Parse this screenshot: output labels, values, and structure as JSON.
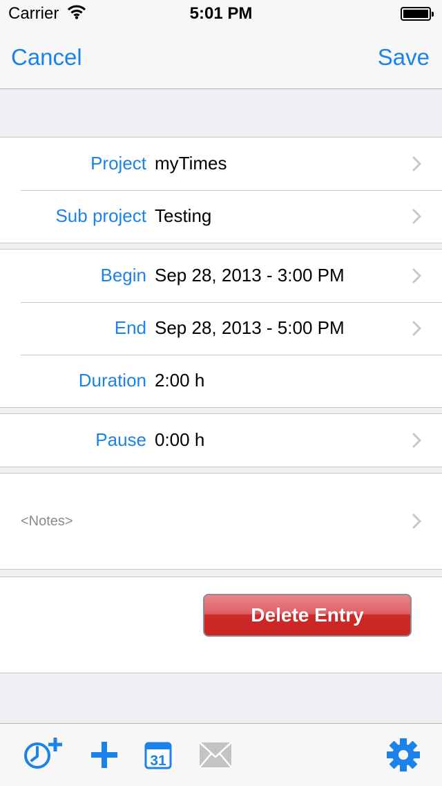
{
  "status_bar": {
    "carrier": "Carrier",
    "time": "5:01 PM"
  },
  "nav": {
    "cancel_label": "Cancel",
    "save_label": "Save"
  },
  "project_group": {
    "project_label": "Project",
    "project_value": "myTimes",
    "subproject_label": "Sub project",
    "subproject_value": "Testing"
  },
  "time_group": {
    "begin_label": "Begin",
    "begin_value": "Sep 28, 2013 - 3:00 PM",
    "end_label": "End",
    "end_value": "Sep 28, 2013 - 5:00 PM",
    "duration_label": "Duration",
    "duration_value": "2:00 h"
  },
  "pause_group": {
    "pause_label": "Pause",
    "pause_value": "0:00 h"
  },
  "notes_group": {
    "placeholder": "<Notes>"
  },
  "delete_button": {
    "label": "Delete Entry"
  },
  "toolbar": {
    "icons": [
      "clock-add-icon",
      "plus-icon",
      "calendar-icon",
      "mail-icon",
      "gear-icon"
    ],
    "calendar_day": "31",
    "accent_color": "#1a82e8",
    "disabled_color": "#c4c4c4"
  },
  "colors": {
    "accent": "#1a82e8",
    "delete_red": "#cd2323",
    "background": "#efeff4"
  }
}
